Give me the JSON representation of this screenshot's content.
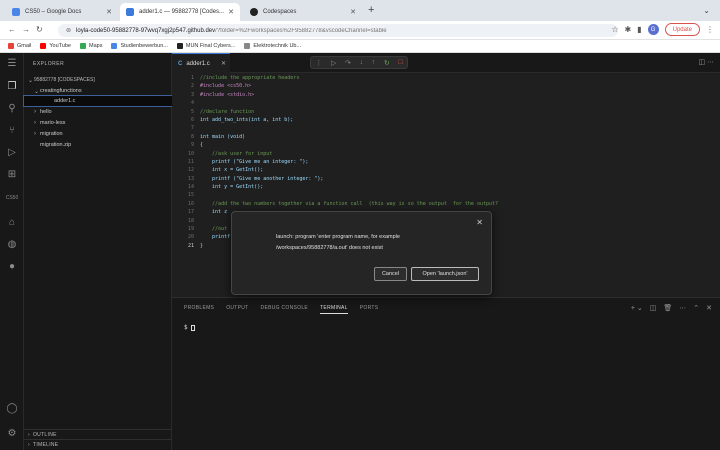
{
  "browser": {
    "tabs": [
      {
        "title": "CS50 – Google Docs",
        "color": "#4a86e8"
      },
      {
        "title": "adder1.c — 95882778 [Codes...",
        "color": "#3b7ad9"
      },
      {
        "title": "Codespaces",
        "color": "#222222"
      }
    ],
    "address": {
      "host": "loyla-code50-95882778-97wvq7xgj2p547.github.dev",
      "path": "/?folder=%2Fworkspaces%2F95882778&vscodeChannel=stable"
    },
    "update_label": "Update",
    "avatar_letter": "G",
    "bookmarks": [
      {
        "label": "Gmail",
        "color": "#ea4335"
      },
      {
        "label": "YouTube",
        "color": "#ff0000"
      },
      {
        "label": "Maps",
        "color": "#34a853"
      },
      {
        "label": "Studienbewerbun...",
        "color": "#4a86e8"
      },
      {
        "label": "MUN Final Cybers...",
        "color": "#222222"
      },
      {
        "label": "Elektrotechnik Ub...",
        "color": "#888888"
      }
    ]
  },
  "explorer": {
    "header": "EXPLORER",
    "root": "95882778 [CODESPACES]",
    "items": [
      {
        "label": "creatingfunctions",
        "chev": "⌄"
      },
      {
        "label": "adder1.c",
        "chev": ""
      },
      {
        "label": "hello",
        "chev": "›"
      },
      {
        "label": "mario-less",
        "chev": "›"
      },
      {
        "label": "migration",
        "chev": "›"
      },
      {
        "label": "migration.zip",
        "chev": ""
      }
    ],
    "outline": "OUTLINE",
    "timeline": "TIMELINE"
  },
  "editor": {
    "tab": "adder1.c",
    "lines": [
      {
        "n": "1",
        "t": "//include the appropriate headers"
      },
      {
        "n": "2",
        "t": "#include <cs50.h>"
      },
      {
        "n": "3",
        "t": "#include <stdio.h>"
      },
      {
        "n": "4",
        "t": ""
      },
      {
        "n": "5",
        "t": "//declare function"
      },
      {
        "n": "6",
        "t": "int add_two_ints(int a, int b);"
      },
      {
        "n": "7",
        "t": ""
      },
      {
        "n": "8",
        "t": "int main (void)"
      },
      {
        "n": "9",
        "t": "{"
      },
      {
        "n": "10",
        "t": "    //ask user for input"
      },
      {
        "n": "11",
        "t": "    printf (\"Give me an integer: \");"
      },
      {
        "n": "12",
        "t": "    int x = GetInt();"
      },
      {
        "n": "13",
        "t": "    printf (\"Give me another integer: \");"
      },
      {
        "n": "14",
        "t": "    int y = GetInt();"
      },
      {
        "n": "15",
        "t": ""
      },
      {
        "n": "16",
        "t": "    //add the two numbers together via a function call  (this way is so the output  for the output?"
      },
      {
        "n": "17",
        "t": "    int z"
      },
      {
        "n": "18",
        "t": ""
      },
      {
        "n": "19",
        "t": "    //out"
      },
      {
        "n": "20",
        "t": "    printf"
      },
      {
        "n": "21",
        "t": "}"
      }
    ]
  },
  "panel": {
    "tabs": [
      "PROBLEMS",
      "OUTPUT",
      "DEBUG CONSOLE",
      "TERMINAL",
      "PORTS"
    ],
    "active_tab": "TERMINAL",
    "prompt": "$"
  },
  "dialog": {
    "message_line1": "launch: program 'enter program name, for example",
    "message_line2": "/workspaces/95882778/a.out' does not exist",
    "cancel_label": "Cancel",
    "open_label": "Open 'launch.json'"
  }
}
